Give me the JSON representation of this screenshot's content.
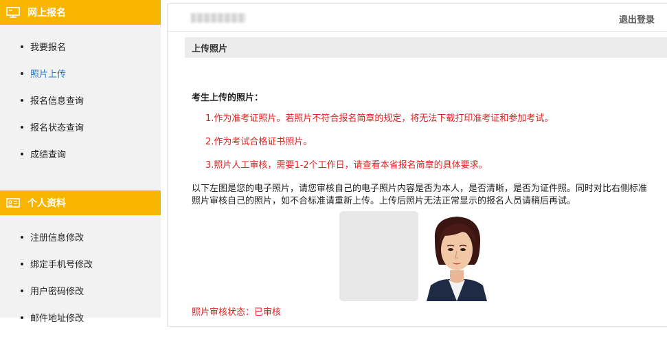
{
  "sidebar": {
    "section1": {
      "title": "网上报名",
      "icon": "monitor-icon",
      "items": [
        {
          "label": "我要报名"
        },
        {
          "label": "照片上传"
        },
        {
          "label": "报名信息查询"
        },
        {
          "label": "报名状态查询"
        },
        {
          "label": "成绩查询"
        }
      ]
    },
    "section2": {
      "title": "个人资料",
      "icon": "id-card-icon",
      "items": [
        {
          "label": "注册信息修改"
        },
        {
          "label": "绑定手机号修改"
        },
        {
          "label": "用户密码修改"
        },
        {
          "label": "邮件地址修改"
        }
      ]
    },
    "active_item": "照片上传",
    "accent_color": "#f7b500",
    "active_color": "#2e7bc4"
  },
  "header": {
    "logout_label": "退出登录"
  },
  "main": {
    "section_title": "上传照片",
    "heading": "考生上传的照片：",
    "rules": [
      "1.作为准考证照片。若照片不符合报名简章的规定，将无法下载打印准考证和参加考试。",
      "2.作为考试合格证书照片。",
      "3.照片人工审核，需要1-2个工作日，请查看本省报名简章的具体要求。"
    ],
    "description": "以下左图是您的电子照片，请您审核自己的电子照片内容是否为本人，是否清晰，是否为证件照。同时对比右侧标准照片审核自己的照片，如不合标准请重新上传。上传后照片无法正常显示的报名人员请稍后再试。",
    "status_text": "照片审核状态：已审核",
    "warning_color": "#e02020"
  }
}
